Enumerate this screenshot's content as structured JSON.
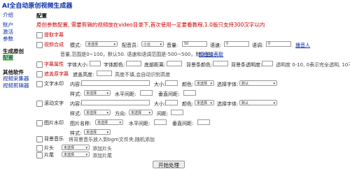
{
  "app": {
    "title": "AI全自动原创视频生成器"
  },
  "sidebar": {
    "items": [
      {
        "label": "介绍"
      },
      {
        "label": "账户"
      },
      {
        "label": "激活"
      },
      {
        "label": "参数"
      }
    ],
    "group1": "生成原创",
    "active": "配置",
    "group2": "其他软件",
    "others": [
      {
        "label": "视频采集器"
      },
      {
        "label": "视频剪辑器"
      }
    ]
  },
  "main": {
    "title": "配置",
    "description": "原创参数配置, 需要剪辑的视频放在video目录下,首次使用一定要看教程,1.0版只支持300汉字以内",
    "extract": "提取字幕",
    "voice": {
      "label": "视频合成",
      "mode_label": "模式:",
      "mode_value": "未选择",
      "voice_label": "配音员:",
      "voice_value": "小云",
      "volume_label": "音量:",
      "volume_value": "50",
      "speed_label": "语速:",
      "speed_value": "0",
      "pitch_label": "语调:",
      "pitch_value": "0",
      "voice_link": "播音人",
      "note": "音量,范围是0~100，默认50. 语速和语调范围是-500~500，默认是0",
      "color_link": "颜色值表取"
    },
    "subtitle": {
      "label": "字幕属性",
      "size_label": "字体大小:",
      "font_color_label": "字体颜色:",
      "bottom_label": "底部距离:",
      "bg_color_label": "背景条颜色:",
      "bg_alpha_label": "背景条透明度:",
      "alpha_note": "透明度 0-10, 0表示完全透明, 10不透明"
    },
    "mask": {
      "label": "遮盖原字幕",
      "height_label": "遮盖高度:",
      "note": "高度不填,会自动识别高度"
    },
    "watermark": {
      "label": "文字水印",
      "content_label": "内容:",
      "size_label": "大小:",
      "color_label": "颜色:",
      "color_value": "未选择",
      "font_label": "选择字体:",
      "font_value": "默认",
      "style_label": "样式:",
      "style_value": "未选择",
      "hspace_label": "水平间距:",
      "vspace_label": "垂直间距:"
    },
    "scroll": {
      "label": "滚动文字",
      "content_label": "内容:",
      "size_label": "大小:",
      "color_label": "颜色:",
      "color_value": "未选择",
      "font_label": "选择字体:",
      "font_value": "默认",
      "style_label": "样式:",
      "style_value": "未选择",
      "direction_label": "方向:",
      "direction_value": "未选择",
      "spacing_label": "间距:"
    },
    "image_wm": {
      "label": "图片水印",
      "name_label": "图片名称:",
      "name_value": "未选择",
      "hspace_label": "水平间距:",
      "vspace_label": "垂直间距:",
      "style_label": "样式:",
      "style_value": "未选择"
    },
    "bgm": {
      "label": "背景音乐",
      "note": "将背景音乐放入到bgm文件夹,随机添加"
    },
    "intro": {
      "label": "片头",
      "value": "未选择",
      "note": "添加片头"
    },
    "outro": {
      "label": "片尾",
      "value": "未选择",
      "note": "添加片尾"
    },
    "start_button": "开始处理"
  }
}
